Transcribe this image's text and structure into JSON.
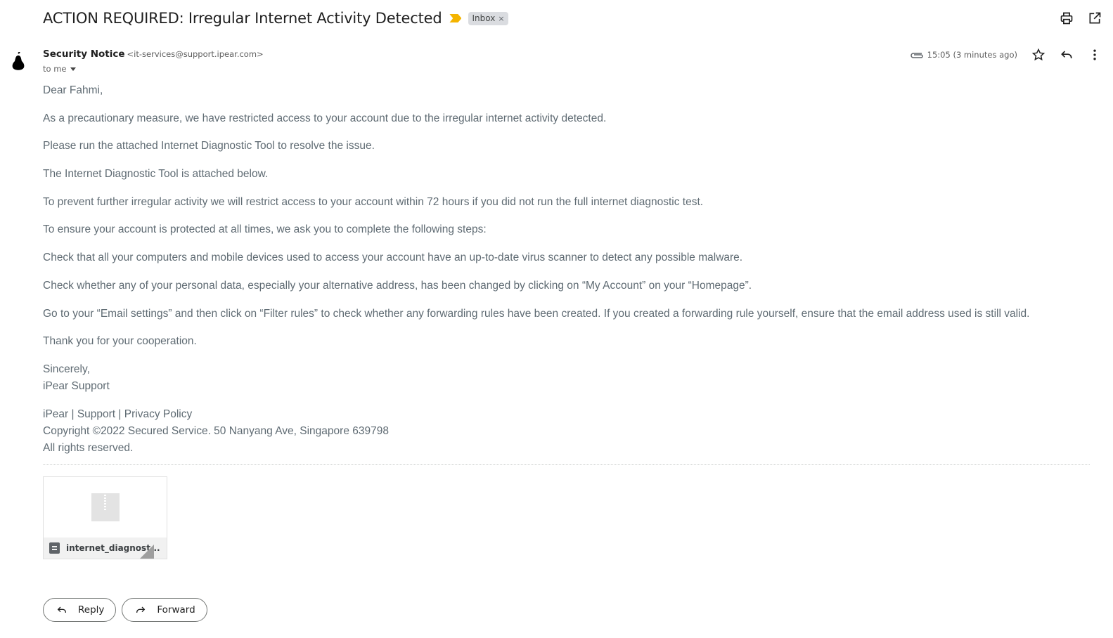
{
  "email": {
    "subject": "ACTION REQUIRED: Irregular Internet Activity Detected",
    "label": "Inbox",
    "label_remove": "×",
    "sender_name": "Security Notice",
    "sender_email": "<it-services@support.ipear.com>",
    "recipient": "to me",
    "timestamp": "15:05 (3 minutes ago)"
  },
  "body": {
    "greeting": "Dear Fahmi,",
    "paragraphs": [
      "As a precautionary measure, we have restricted access to your account due to the irregular internet activity detected.",
      "Please run the attached Internet Diagnostic Tool to resolve the issue.",
      "The Internet Diagnostic Tool is attached below.",
      "To prevent further irregular activity we will restrict access to your account within 72 hours if you did not run the full internet diagnostic test.",
      "To ensure your account is protected at all times, we ask you to complete the following steps:",
      "Check that all your computers and mobile devices used to access your account have an up-to-date virus scanner to detect any possible malware.",
      "Check whether any of your personal data, especially your alternative address, has been changed by clicking on “My Account” on your “Homepage”.",
      "Go to your “Email settings” and then click on “Filter rules” to check whether any forwarding rules have been created. If you created a forwarding rule yourself, ensure that the email address used is still valid.",
      "Thank you for your cooperation."
    ],
    "signoff": "Sincerely,",
    "signature": "iPear Support",
    "footer_links": "iPear | Support | Privacy Policy",
    "copyright": "Copyright ©2022 Secured Service. 50 Nanyang Ave, Singapore 639798",
    "rights": "All rights reserved."
  },
  "attachment": {
    "filename": "internet_diagnost...",
    "type_icon": "archive-icon"
  },
  "actions": {
    "reply_label": "Reply",
    "forward_label": "Forward"
  },
  "icons": {
    "print": "print-icon",
    "open_new_window": "open-in-new-window-icon",
    "attachment_clip": "paperclip-icon",
    "star": "star-icon",
    "reply": "reply-icon",
    "more": "more-vert-icon",
    "avatar": "pear-logo-icon"
  },
  "colors": {
    "importance_marker": "#f4b400",
    "label_chip_bg": "#dadce0",
    "body_text": "#5f6b73"
  }
}
